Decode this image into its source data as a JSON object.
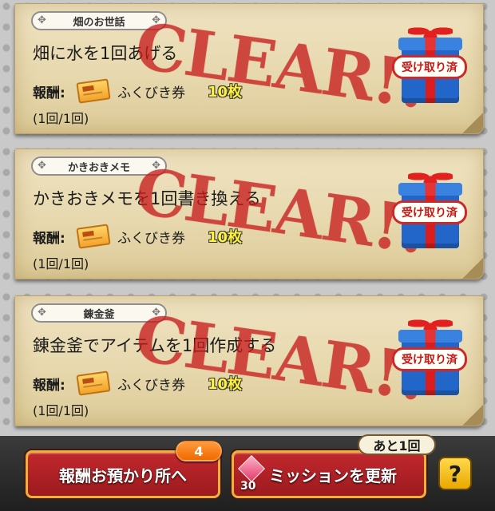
{
  "missions": [
    {
      "category": "畑のお世話",
      "text": "畑に水を1回あげる",
      "reward_label": "報酬:",
      "reward_name": "ふくびき券",
      "reward_qty": "10枚",
      "progress": "(1回/1回)",
      "stamp": "CLEAR!!",
      "status_label": "受け取り済"
    },
    {
      "category": "かきおきメモ",
      "text": "かきおきメモを1回書き換える",
      "reward_label": "報酬:",
      "reward_name": "ふくびき券",
      "reward_qty": "10枚",
      "progress": "(1回/1回)",
      "stamp": "CLEAR!!",
      "status_label": "受け取り済"
    },
    {
      "category": "錬金釜",
      "text": "錬金釜でアイテムを1回作成する",
      "reward_label": "報酬:",
      "reward_name": "ふくびき券",
      "reward_qty": "10枚",
      "progress": "(1回/1回)",
      "stamp": "CLEAR!!",
      "status_label": "受け取り済"
    }
  ],
  "footer": {
    "reward_storage_label": "報酬お預かり所へ",
    "reward_storage_count": "4",
    "update_label": "ミッションを更新",
    "update_cost": "30",
    "update_remaining": "あと1回",
    "help_label": "?"
  }
}
